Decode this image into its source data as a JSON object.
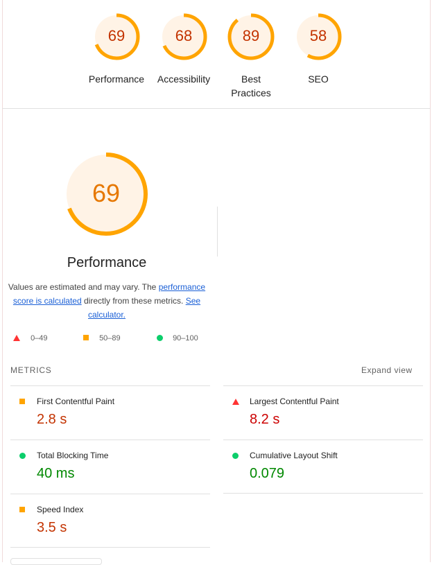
{
  "categories": [
    {
      "score": "69",
      "label": "Performance",
      "fraction": 0.69
    },
    {
      "score": "68",
      "label": "Accessibility",
      "fraction": 0.68
    },
    {
      "score": "89",
      "label": "Best Practices",
      "fraction": 0.89
    },
    {
      "score": "58",
      "label": "SEO",
      "fraction": 0.58
    }
  ],
  "main": {
    "score": "69",
    "fraction": 0.69,
    "title": "Performance",
    "desc_text1": "Values are estimated and may vary. The",
    "desc_link1": "performance score is calculated",
    "desc_text2": "directly from these metrics.",
    "desc_link2": "See calculator."
  },
  "legend": {
    "fail": "0–49",
    "average": "50–89",
    "pass": "90–100"
  },
  "metrics": {
    "heading": "METRICS",
    "expand_label": "Expand view",
    "items": [
      {
        "label": "First Contentful Paint",
        "value": "2.8 s",
        "status": "average"
      },
      {
        "label": "Largest Contentful Paint",
        "value": "8.2 s",
        "status": "fail"
      },
      {
        "label": "Total Blocking Time",
        "value": "40 ms",
        "status": "pass"
      },
      {
        "label": "Cumulative Layout Shift",
        "value": "0.079",
        "status": "pass"
      },
      {
        "label": "Speed Index",
        "value": "3.5 s",
        "status": "average"
      }
    ]
  },
  "colors": {
    "average": "#ffa400",
    "average_text": "#c33300",
    "fail": "#ff3333",
    "pass": "#0cce6b",
    "gauge_bg": "#fff3e6"
  }
}
